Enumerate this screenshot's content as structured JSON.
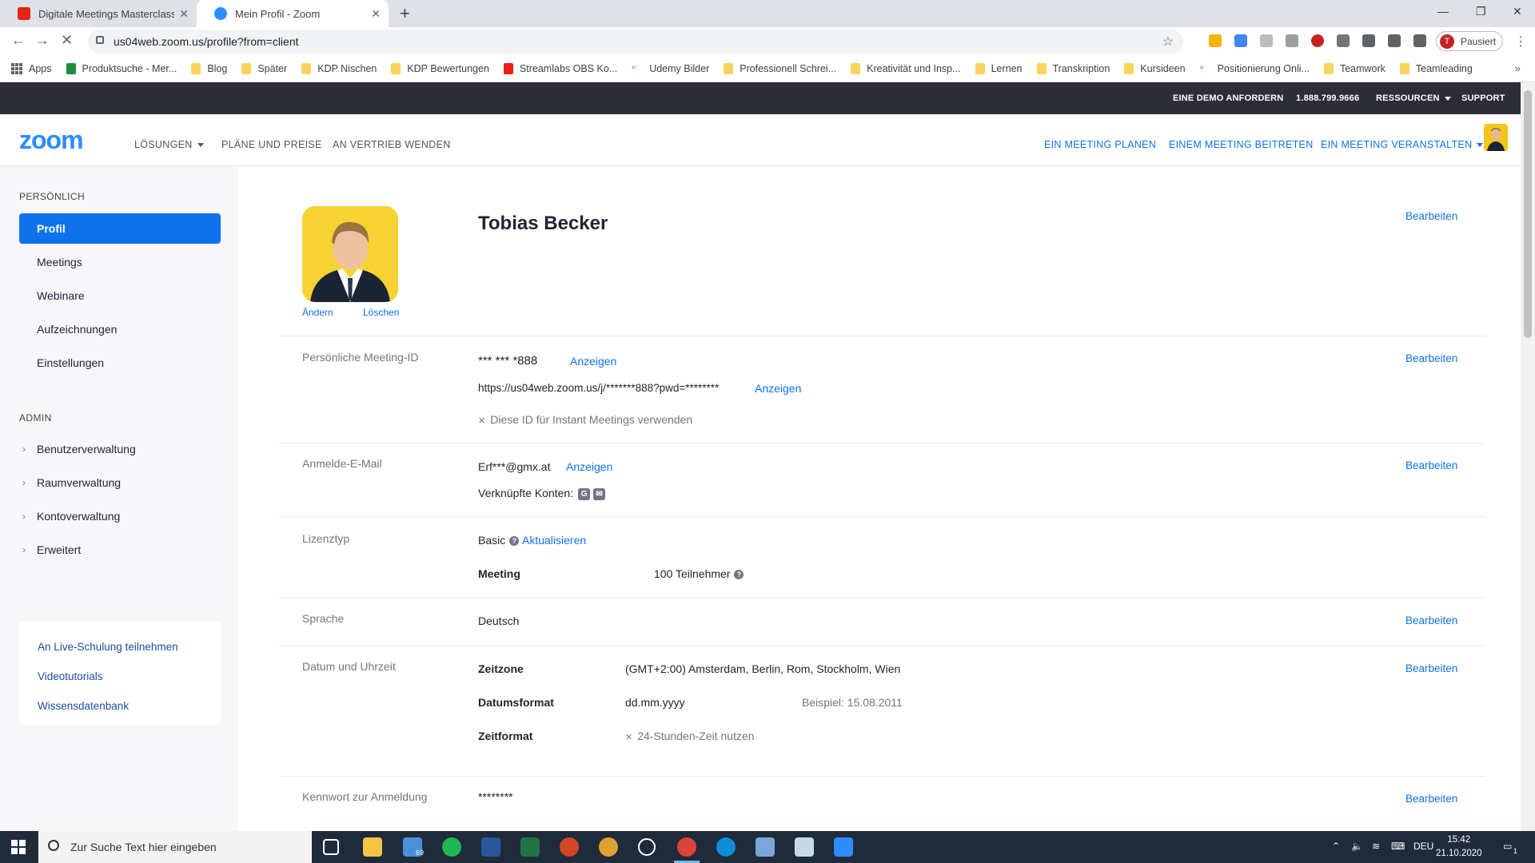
{
  "browser": {
    "tabs": [
      {
        "title": "Digitale Meetings Masterclass: Be",
        "active": false
      },
      {
        "title": "Mein Profil - Zoom",
        "active": true
      }
    ],
    "url": "us04web.zoom.us/profile?from=client",
    "profile_label": "Pausiert",
    "profile_initial": "T",
    "bookmarks": [
      "Apps",
      "Produktsuche - Mer...",
      "Blog",
      "Später",
      "KDP Nischen",
      "KDP Bewertungen",
      "Streamlabs OBS Ko...",
      "Udemy Bilder",
      "Professionell Schrei...",
      "Kreativität und Insp...",
      "Lernen",
      "Transkription",
      "Kursideen",
      "Positionierung Onli...",
      "Teamwork",
      "Teamleading"
    ],
    "bookmarks_more": "»"
  },
  "zoom_top": {
    "demo": "EINE DEMO ANFORDERN",
    "phone": "1.888.799.9666",
    "resources": "RESSOURCEN",
    "support": "SUPPORT"
  },
  "zoom_header": {
    "logo": "zoom",
    "nav": {
      "solutions": "LÖSUNGEN",
      "plans": "PLÄNE UND PREISE",
      "sales": "AN VERTRIEB WENDEN",
      "schedule": "EIN MEETING PLANEN",
      "join": "EINEM MEETING BEITRETEN",
      "host": "EIN MEETING VERANSTALTEN"
    }
  },
  "sidebar": {
    "personal_title": "PERSÖNLICH",
    "personal_items": [
      "Profil",
      "Meetings",
      "Webinare",
      "Aufzeichnungen",
      "Einstellungen"
    ],
    "admin_title": "ADMIN",
    "admin_items": [
      "Benutzerverwaltung",
      "Raumverwaltung",
      "Kontoverwaltung",
      "Erweitert"
    ],
    "help_links": [
      "An Live-Schulung teilnehmen",
      "Videotutorials",
      "Wissensdatenbank"
    ]
  },
  "profile": {
    "name": "Tobias Becker",
    "change_photo": "Ändern",
    "delete_photo": "Löschen",
    "edit_label": "Bearbeiten",
    "meeting_id": {
      "label": "Persönliche Meeting-ID",
      "value": "*** *** *888",
      "show": "Anzeigen",
      "link": "https://us04web.zoom.us/j/*******888?pwd=********",
      "link_show": "Anzeigen",
      "instant": "Diese ID für Instant Meetings verwenden"
    },
    "email": {
      "label": "Anmelde-E-Mail",
      "value": "Erf***@gmx.at",
      "show": "Anzeigen",
      "linked": "Verknüpfte Konten:"
    },
    "license": {
      "label": "Lizenztyp",
      "value": "Basic",
      "upgrade": "Aktualisieren",
      "meeting_label": "Meeting",
      "meeting_value": "100 Teilnehmer"
    },
    "language": {
      "label": "Sprache",
      "value": "Deutsch"
    },
    "datetime": {
      "label": "Datum und Uhrzeit",
      "timezone_label": "Zeitzone",
      "timezone_value": "(GMT+2:00) Amsterdam, Berlin, Rom, Stockholm, Wien",
      "dateformat_label": "Datumsformat",
      "dateformat_value": "dd.mm.yyyy",
      "example": "Beispiel: 15.08.2011",
      "timeformat_label": "Zeitformat",
      "timeformat_value": "24-Stunden-Zeit nutzen"
    },
    "password": {
      "label": "Kennwort zur Anmeldung",
      "value": "********"
    }
  },
  "taskbar": {
    "search_placeholder": "Zur Suche Text hier eingeben",
    "mail_badge": "69",
    "lang": "DEU",
    "time": "15:42",
    "date": "21.10.2020",
    "notif": "1"
  },
  "colors": {
    "zoom_blue": "#0e72ed",
    "dark_bar": "#2d2d3a",
    "sidebar_bg": "#f7f7fa"
  }
}
